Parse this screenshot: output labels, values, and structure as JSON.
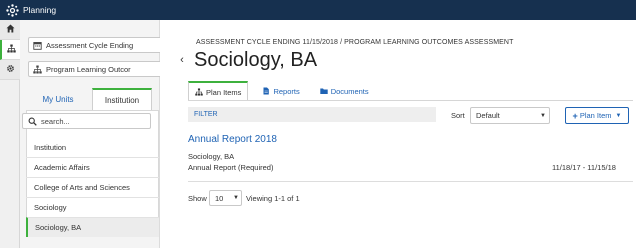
{
  "app": {
    "title": "Planning"
  },
  "rail": {
    "icons": [
      "home-icon",
      "hierarchy-icon",
      "gear-icon"
    ]
  },
  "sidebar": {
    "dropdowns": [
      {
        "label": "Assessment Cycle Ending",
        "icon": "calendar-icon"
      },
      {
        "label": "Program Learning Outcor",
        "icon": "hierarchy-icon"
      }
    ],
    "tabs": [
      {
        "label": "My Units"
      },
      {
        "label": "Institution"
      }
    ],
    "search_placeholder": "search...",
    "units": [
      "Institution",
      "Academic Affairs",
      "College of Arts and Sciences",
      "Sociology",
      "Sociology, BA"
    ],
    "selected_unit": "Sociology, BA"
  },
  "main": {
    "breadcrumb": "ASSESSMENT CYCLE ENDING 11/15/2018 / PROGRAM LEARNING OUTCOMES ASSESSMENT",
    "title": "Sociology, BA",
    "tabs": [
      {
        "label": "Plan Items",
        "icon": "hierarchy-icon"
      },
      {
        "label": "Reports",
        "icon": "document-icon"
      },
      {
        "label": "Documents",
        "icon": "folder-icon"
      }
    ],
    "filter_label": "FILTER",
    "sort_label": "Sort",
    "sort_value": "Default",
    "plan_item_button": "Plan Item",
    "report": {
      "title": "Annual Report 2018",
      "unit": "Sociology, BA",
      "type": "Annual Report (Required)",
      "dates": "11/18/17 - 11/15/18"
    },
    "show_label": "Show",
    "show_value": "10",
    "viewing_text": "Viewing 1-1 of 1"
  },
  "colors": {
    "topbar": "#16304f",
    "accent_green": "#3db13d",
    "link_blue": "#1f63b4"
  }
}
